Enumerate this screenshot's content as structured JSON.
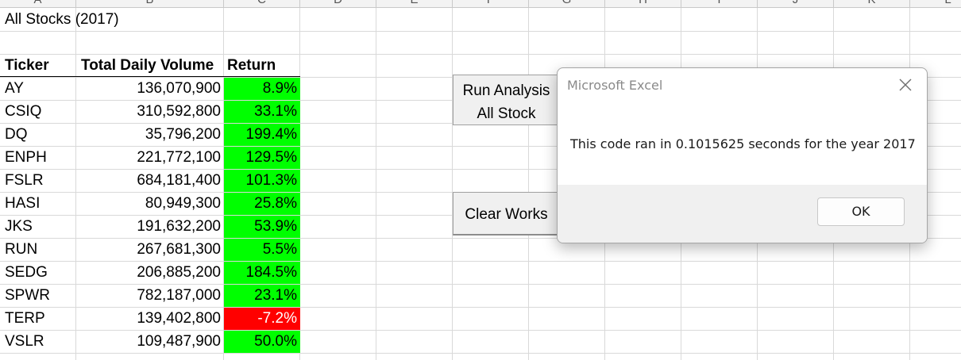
{
  "sheet": {
    "column_headers": [
      "A",
      "B",
      "C",
      "D",
      "E",
      "F",
      "G",
      "H",
      "I",
      "J",
      "K",
      "L"
    ],
    "title_cell": "All Stocks (2017)",
    "table": {
      "headers": {
        "ticker": "Ticker",
        "volume": "Total Daily Volume",
        "return": "Return"
      },
      "rows": [
        {
          "ticker": "AY",
          "volume": "136,070,900",
          "return": "8.9%",
          "positive": true
        },
        {
          "ticker": "CSIQ",
          "volume": "310,592,800",
          "return": "33.1%",
          "positive": true
        },
        {
          "ticker": "DQ",
          "volume": "35,796,200",
          "return": "199.4%",
          "positive": true
        },
        {
          "ticker": "ENPH",
          "volume": "221,772,100",
          "return": "129.5%",
          "positive": true
        },
        {
          "ticker": "FSLR",
          "volume": "684,181,400",
          "return": "101.3%",
          "positive": true
        },
        {
          "ticker": "HASI",
          "volume": "80,949,300",
          "return": "25.8%",
          "positive": true
        },
        {
          "ticker": "JKS",
          "volume": "191,632,200",
          "return": "53.9%",
          "positive": true
        },
        {
          "ticker": "RUN",
          "volume": "267,681,300",
          "return": "5.5%",
          "positive": true
        },
        {
          "ticker": "SEDG",
          "volume": "206,885,200",
          "return": "184.5%",
          "positive": true
        },
        {
          "ticker": "SPWR",
          "volume": "782,187,000",
          "return": "23.1%",
          "positive": true
        },
        {
          "ticker": "TERP",
          "volume": "139,402,800",
          "return": "-7.2%",
          "positive": false
        },
        {
          "ticker": "VSLR",
          "volume": "109,487,900",
          "return": "50.0%",
          "positive": true
        }
      ]
    },
    "colors": {
      "positive": "#00ff00",
      "negative": "#ff0000",
      "gridline": "#d9d9d9"
    }
  },
  "buttons": {
    "run_analysis_line1": "Run Analysis",
    "run_analysis_line2": "All Stock",
    "clear_worksheet": "Clear Works"
  },
  "dialog": {
    "title": "Microsoft Excel",
    "close_icon": "close-icon",
    "message": "This code ran in 0.1015625 seconds for the year 2017",
    "ok_label": "OK"
  }
}
